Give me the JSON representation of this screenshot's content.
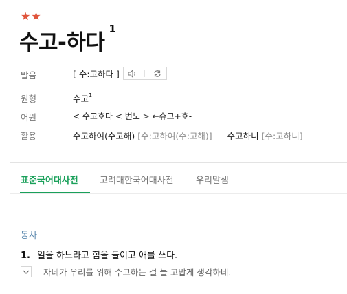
{
  "entry": {
    "stars": "★★",
    "headword": "수고-하다",
    "homonym_number": "1"
  },
  "rows": {
    "pronunciation_label": "발음",
    "pronunciation_value": "[ 수:고하다 ]",
    "origin_label": "원형",
    "origin_value": "수고",
    "origin_sup": "1",
    "etymology_label": "어원",
    "etymology_value": "< 수고ᄒᆞ다 < 번노 > ←슈고+ᄒᆞ-",
    "conjugation_label": "활용",
    "conjugation_1": "수고하여(수고해)",
    "conjugation_1_pron": "[수:고하여(수:고해)]",
    "conjugation_2": "수고하니",
    "conjugation_2_pron": "[수:고하니]"
  },
  "icons": {
    "audio": "speaker-icon",
    "repeat": "repeat-icon",
    "toggle": "chevron-down-icon"
  },
  "tabs": [
    {
      "label": "표준국어대사전",
      "active": true
    },
    {
      "label": "고려대한국어대사전",
      "active": false
    },
    {
      "label": "우리말샘",
      "active": false
    }
  ],
  "definition": {
    "pos": "동사",
    "number": "1.",
    "sense": "일을 하느라고 힘을 들이고 애를 쓰다.",
    "example": "자네가 우리를 위해 수고하는 걸 늘 고맙게 생각하네."
  },
  "colors": {
    "stars": "#e0553c",
    "active_tab": "#1aa05a",
    "pos": "#5f8bb0"
  }
}
